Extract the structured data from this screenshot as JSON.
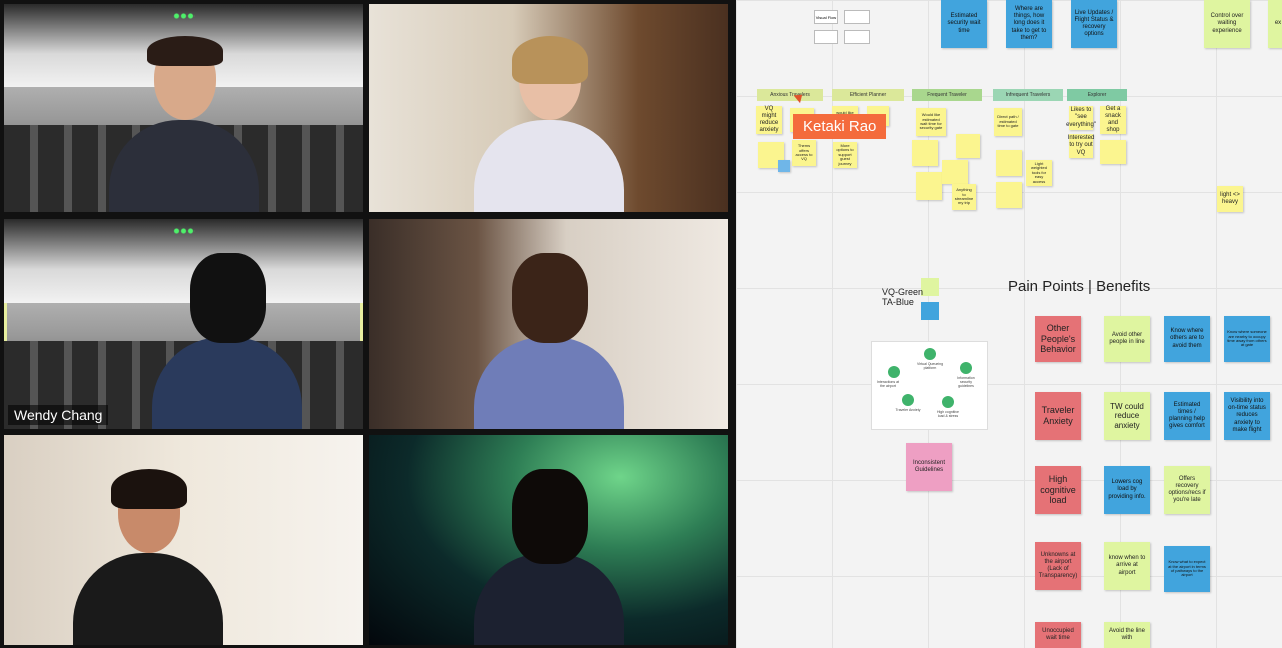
{
  "gallery": {
    "participants": [
      {
        "label": ""
      },
      {
        "label": ""
      },
      {
        "label": "Wendy Chang",
        "active": true
      },
      {
        "label": ""
      },
      {
        "label": ""
      },
      {
        "label": ""
      }
    ]
  },
  "board": {
    "cursor_label": "Ketaki Rao",
    "top_notes": [
      "Estimated security wait time",
      "Where are things, how long does it take to get to them?",
      "Live Updates / Flight Status & recovery options",
      "Control over waiting experience",
      "ex"
    ],
    "small_frames": [
      "Visual Flow",
      "",
      "",
      "",
      "",
      ""
    ],
    "headers": [
      "Anxious Travelers",
      "Efficient Planner",
      "Frequent Traveler",
      "Infrequent Travelers",
      "Explorer"
    ],
    "cluster_notes": [
      "VQ might reduce anxiety",
      "would like to",
      "I like",
      "Would like estimated wait time for security gate",
      "Direct path / estimated time to gate",
      "Likes to \"see everything\"",
      "Get a snack and shop",
      "Interested to try out VQ",
      "Thems offers access to VQ",
      "More options to support guest journey",
      "Light weighted tools for easy access",
      "Anything to streamline my trip",
      "light <> heavy"
    ],
    "legend": {
      "green": "VQ-Green",
      "blue": "TA-Blue"
    },
    "section_title": "Pain Points | Benefits",
    "inconsistent": "Inconsistent Guidelines",
    "pain_points": [
      "Other People's Behavior",
      "Traveler Anxiety",
      "High cognitive load",
      "Unknowns at the airport (Lack of Transparency)",
      "Unoccupied wait time"
    ],
    "vq_benefits": [
      "Avoid other people in line",
      "TW could reduce anxiety",
      "Lowers cog load by providing info.",
      "know when to arrive at airport",
      "Avoid the line with"
    ],
    "ta_benefits": [
      "Know where others are to avoid them",
      "Estimated times / planning help gives comfort",
      "Offers recovery options/recs if you're late",
      "Know what to expect at the airport in terms of pathways to the airport"
    ],
    "far_right": [
      "Know where someone are nearby to occupy time away from others at gate",
      "Visibility into on-time status reduces anxiety to make flight"
    ],
    "diagram_labels": [
      "Interactions at the airport",
      "Virtual Queueing platform",
      "Information security guidelines",
      "Traveler Anxiety",
      "High cognitive load & stress"
    ]
  }
}
